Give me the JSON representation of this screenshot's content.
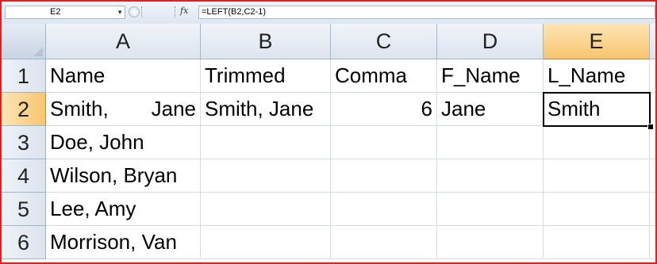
{
  "formula_bar": {
    "name_box": "E2",
    "fx_icon": "fx-icon",
    "fx_text": "fx",
    "formula": "=LEFT(B2,C2-1)"
  },
  "columns": [
    "A",
    "B",
    "C",
    "D",
    "E"
  ],
  "rows": [
    "1",
    "2",
    "3",
    "4",
    "5",
    "6"
  ],
  "cells": {
    "A1": "Name",
    "B1": "Trimmed",
    "C1": "Comma",
    "D1": "F_Name",
    "E1": "L_Name",
    "A2_left": "Smith,",
    "A2_right": "Jane",
    "B2": "Smith, Jane",
    "C2": "6",
    "D2": "Jane",
    "E2": "Smith",
    "A3": "Doe, John",
    "A4": "Wilson, Bryan",
    "A5": "Lee, Amy",
    "A6": "Morrison, Van"
  },
  "selection": {
    "active_cell": "E2"
  },
  "colors": {
    "selection_header": "#f7c56f",
    "window_border": "#e02020",
    "header_fill": "#dce4ee"
  }
}
